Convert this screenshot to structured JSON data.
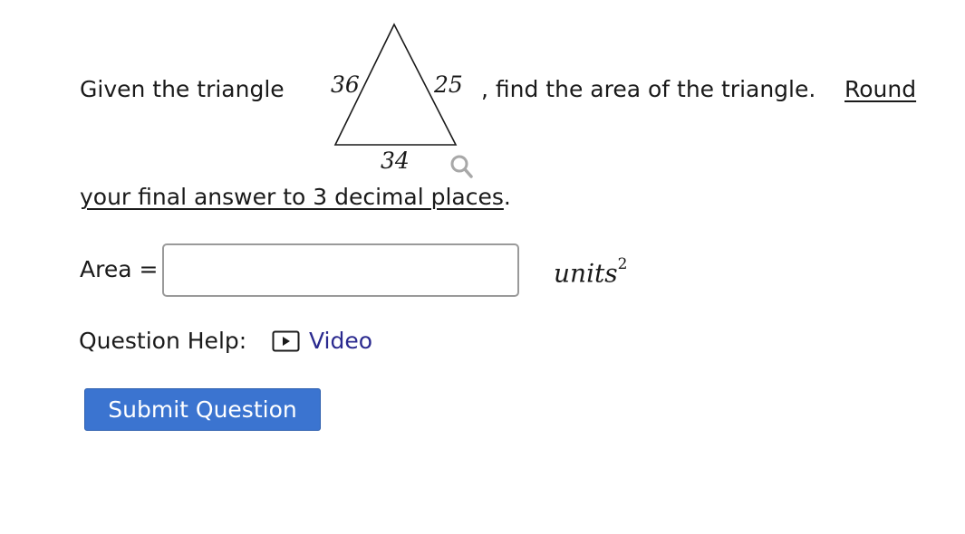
{
  "question": {
    "intro_text": "Given the triangle",
    "after_triangle_text": ", find the area of the triangle.",
    "round_link_line1": "Round",
    "round_link_line2": "your final answer to 3 decimal places",
    "period": "."
  },
  "triangle": {
    "side_left": "36",
    "side_right": "25",
    "side_bottom": "34",
    "zoom_icon": "magnifier-icon"
  },
  "answer": {
    "label": "Area =",
    "value": "",
    "placeholder": "",
    "units_text": "units",
    "units_exponent": "2"
  },
  "help": {
    "label": "Question Help:",
    "video_icon": "play-icon",
    "video_label": "Video"
  },
  "submit": {
    "label": "Submit Question",
    "color": "#3b74d0"
  },
  "colors": {
    "link": "#2b2a8f",
    "text": "#1a1a1a",
    "input_border": "#9a9a9a"
  }
}
